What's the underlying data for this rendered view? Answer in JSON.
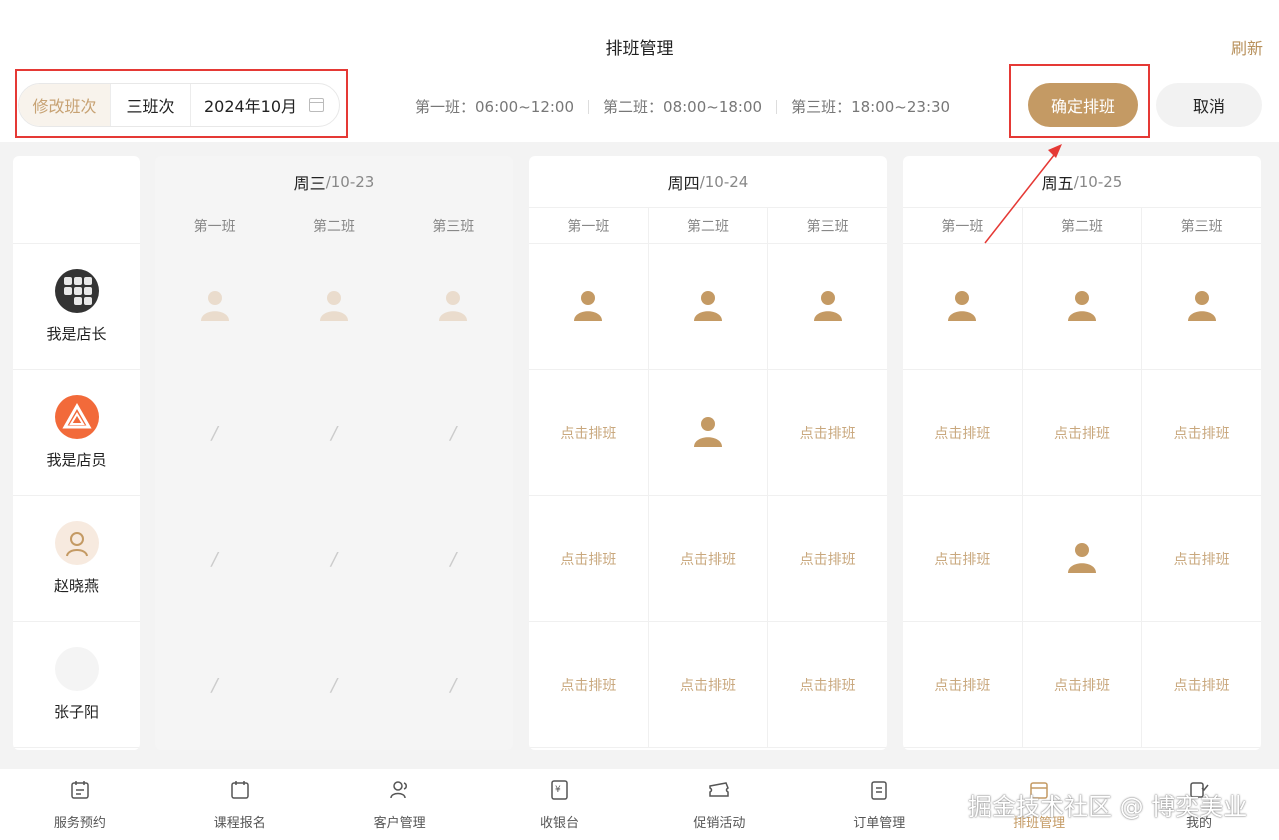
{
  "header": {
    "title": "排班管理",
    "refresh": "刷新",
    "edit_shift": "修改班次",
    "shift_count": "三班次",
    "month": "2024年10月",
    "shifts": [
      "第一班：06:00~12:00",
      "第二班：08:00~18:00",
      "第三班：18:00~23:30"
    ],
    "confirm": "确定排班",
    "cancel": "取消"
  },
  "shift_names": [
    "第一班",
    "第二班",
    "第三班"
  ],
  "staff": [
    {
      "name": "我是店长",
      "avatar": "keyboard-photo"
    },
    {
      "name": "我是店员",
      "avatar": "orange-triangle-logo"
    },
    {
      "name": "赵晓燕",
      "avatar": "woman-icon"
    },
    {
      "name": "张子阳",
      "avatar": "blank"
    }
  ],
  "days": [
    {
      "weekday": "周三",
      "date": "/10-23",
      "past": true,
      "rows": [
        [
          "person-faint",
          "person-faint",
          "person-faint"
        ],
        [
          "/",
          "/",
          "/"
        ],
        [
          "/",
          "/",
          "/"
        ],
        [
          "/",
          "/",
          "/"
        ]
      ]
    },
    {
      "weekday": "周四",
      "date": "/10-24",
      "past": false,
      "rows": [
        [
          "person",
          "person",
          "person"
        ],
        [
          "点击排班",
          "person",
          "点击排班"
        ],
        [
          "点击排班",
          "点击排班",
          "点击排班"
        ],
        [
          "点击排班",
          "点击排班",
          "点击排班"
        ]
      ]
    },
    {
      "weekday": "周五",
      "date": "/10-25",
      "past": false,
      "rows": [
        [
          "person",
          "person",
          "person"
        ],
        [
          "点击排班",
          "点击排班",
          "点击排班"
        ],
        [
          "点击排班",
          "person",
          "点击排班"
        ],
        [
          "点击排班",
          "点击排班",
          "点击排班"
        ]
      ]
    }
  ],
  "nav": [
    {
      "label": "服务预约",
      "icon": "calendar-list-icon"
    },
    {
      "label": "课程报名",
      "icon": "calendar-icon"
    },
    {
      "label": "客户管理",
      "icon": "users-icon"
    },
    {
      "label": "收银台",
      "icon": "cashier-icon"
    },
    {
      "label": "促销活动",
      "icon": "ticket-icon"
    },
    {
      "label": "订单管理",
      "icon": "clipboard-icon"
    },
    {
      "label": "排班管理",
      "icon": "schedule-icon",
      "active": true
    },
    {
      "label": "我的",
      "icon": "profile-icon"
    }
  ],
  "watermark": "掘金技术社区 @ 博奕美业",
  "colors": {
    "accent": "#c49a64",
    "highlight": "#e53935"
  }
}
